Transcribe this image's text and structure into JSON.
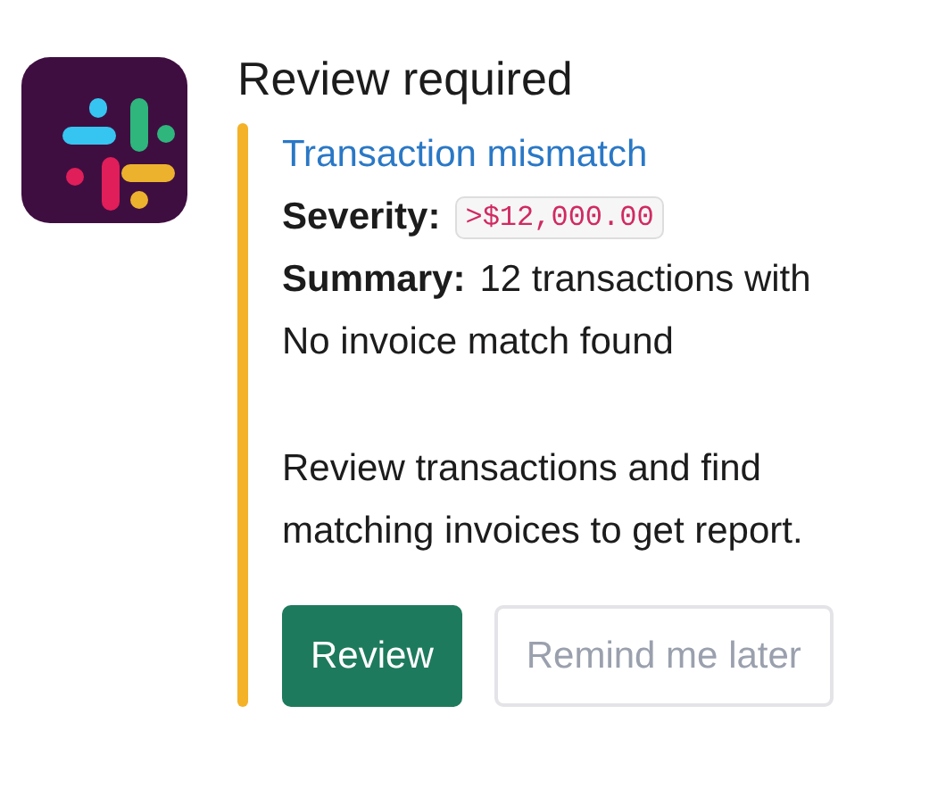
{
  "message": {
    "title": "Review required",
    "attachment": {
      "color": "#f4b228",
      "heading": "Transaction mismatch",
      "fields": [
        {
          "label": "Severity:",
          "value": ">$12,000.00",
          "kind": "code"
        },
        {
          "label": "Summary:",
          "value": "12 transactions with",
          "kind": "text"
        }
      ],
      "lines": [
        "No invoice match found"
      ],
      "body": [
        "Review transactions and find",
        "matching invoices to get report."
      ],
      "buttons": [
        {
          "label": "Review",
          "kind": "primary"
        },
        {
          "label": "Remind me later",
          "kind": "secondary"
        }
      ]
    }
  }
}
